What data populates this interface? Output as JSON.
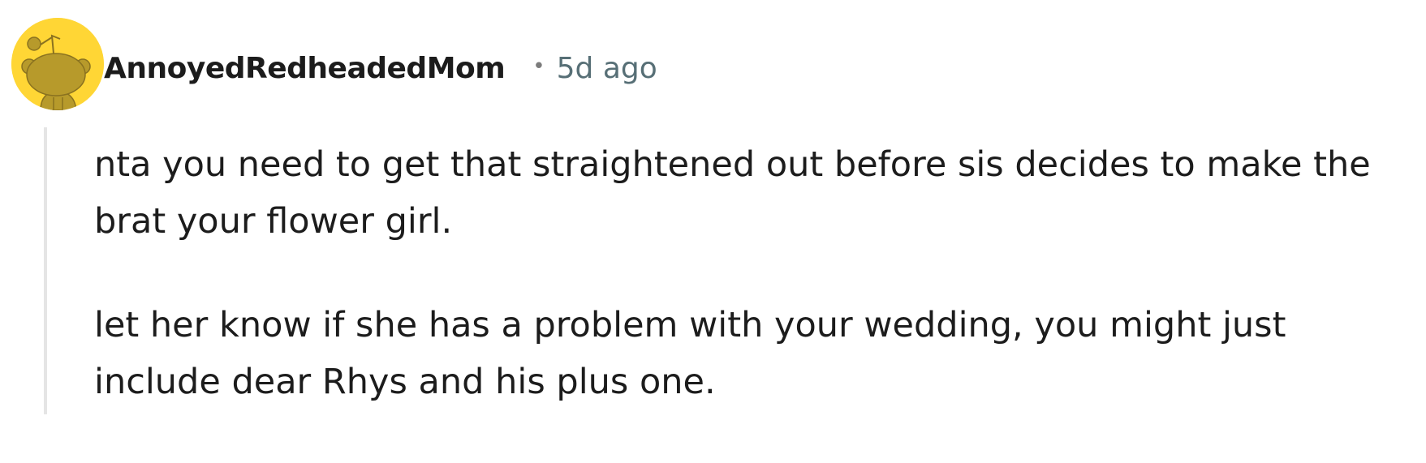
{
  "comment": {
    "author": "AnnoyedRedheadedMom",
    "separator": "•",
    "timestamp": "5d ago",
    "avatar_icon": "reddit-snoo-avatar-icon",
    "avatar_background": "#ffd635",
    "paragraphs": [
      "nta you need to get that straightened out before sis decides to make the brat your flower girl.",
      "let her know if she has a problem with your wedding, you might just include dear Rhys and his plus one."
    ]
  }
}
